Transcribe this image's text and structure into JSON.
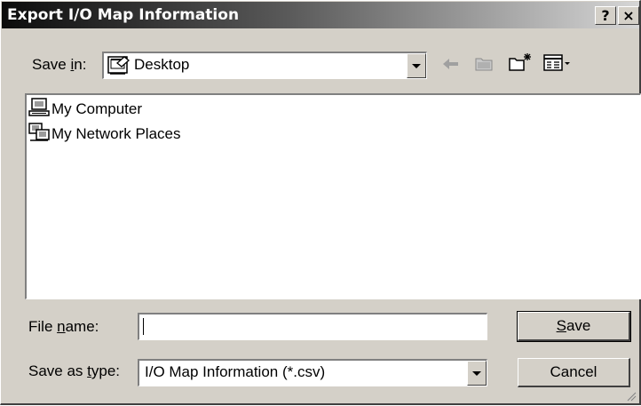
{
  "window": {
    "title": "Export I/O Map Information",
    "help_label": "?",
    "close_label": "×"
  },
  "save_in": {
    "label_pre": "Save ",
    "label_key": "i",
    "label_post": "n:",
    "value": "Desktop",
    "icon": "desktop-icon"
  },
  "toolbar": {
    "back_icon": "back-arrow-icon",
    "up_icon": "up-folder-icon",
    "new_folder_icon": "new-folder-icon",
    "view_icon": "view-menu-icon"
  },
  "files": [
    {
      "label": "My Computer",
      "icon": "computer-icon"
    },
    {
      "label": "My Network Places",
      "icon": "network-places-icon"
    }
  ],
  "file_name": {
    "label_pre": "File ",
    "label_key": "n",
    "label_post": "ame:",
    "value": ""
  },
  "save_type": {
    "label_pre": "Save as ",
    "label_key": "t",
    "label_post": "ype:",
    "value": "I/O Map Information (*.csv)"
  },
  "buttons": {
    "save_key": "S",
    "save_rest": "ave",
    "cancel": "Cancel"
  }
}
